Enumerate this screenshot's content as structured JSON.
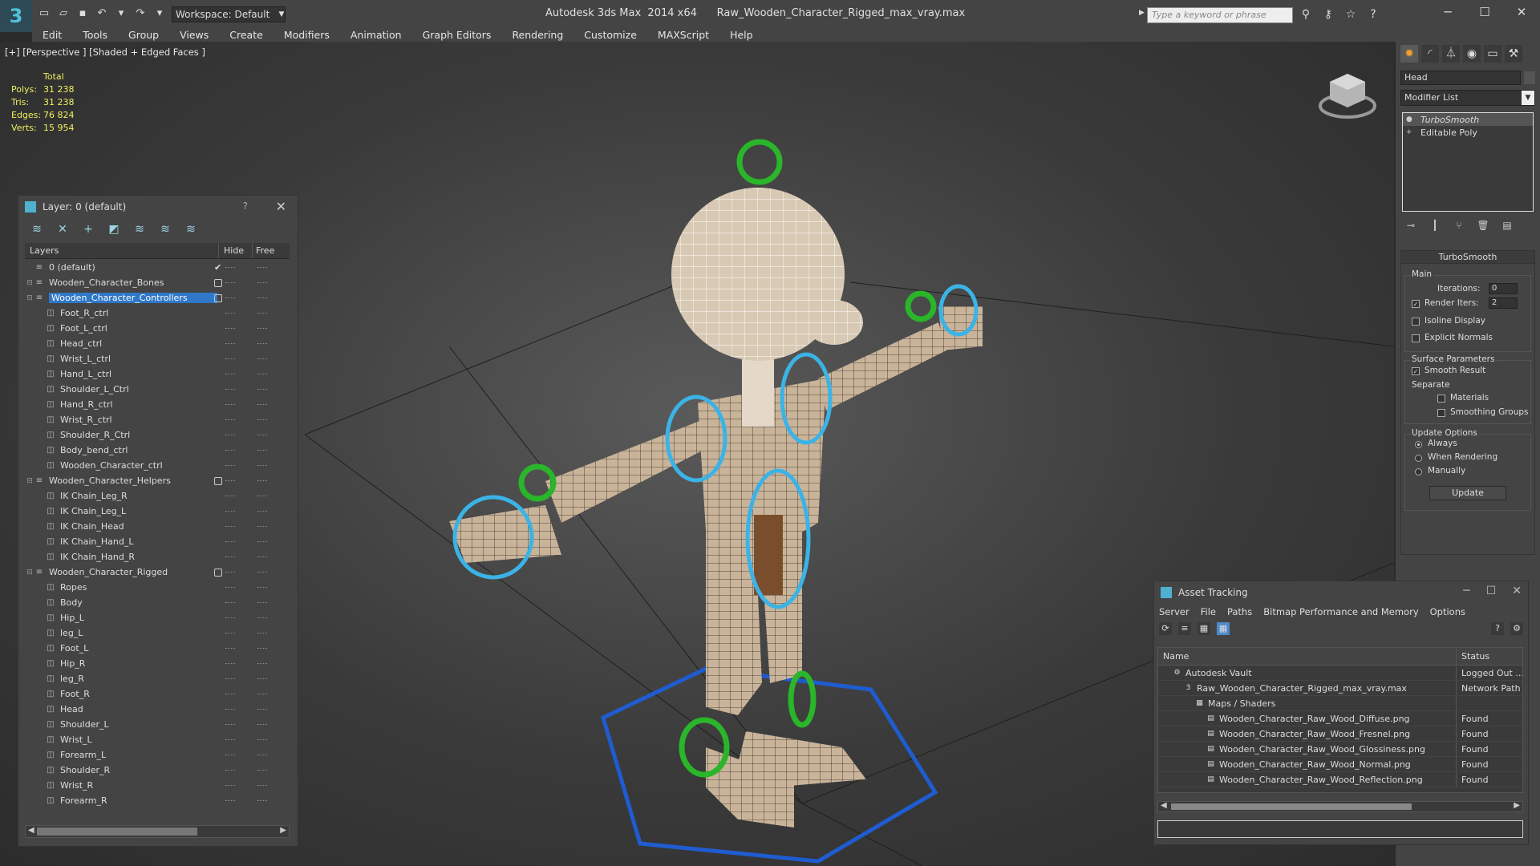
{
  "titlebar": {
    "workspace": "Workspace: Default",
    "app_title": "Autodesk 3ds Max  2014 x64      Raw_Wooden_Character_Rigged_max_vray.max",
    "search_placeholder": "Type a keyword or phrase"
  },
  "menu": [
    "Edit",
    "Tools",
    "Group",
    "Views",
    "Create",
    "Modifiers",
    "Animation",
    "Graph Editors",
    "Rendering",
    "Customize",
    "MAXScript",
    "Help"
  ],
  "viewport": {
    "label": "[+] [Perspective ] [Shaded + Edged Faces ]",
    "stats": {
      "header": "Total",
      "rows": [
        {
          "k": "Polys:",
          "v": "31 238"
        },
        {
          "k": "Tris:",
          "v": "31 238"
        },
        {
          "k": "Edges:",
          "v": "76 824"
        },
        {
          "k": "Verts:",
          "v": "15 954"
        }
      ]
    }
  },
  "layer_window": {
    "title": "Layer: 0 (default)",
    "help": "?",
    "col_layers": "Layers",
    "col_hide": "Hide",
    "col_freeze": "Free",
    "rows": [
      {
        "name": "0 (default)",
        "level": 0,
        "exp": "",
        "mark": "tick"
      },
      {
        "name": "Wooden_Character_Bones",
        "level": 0,
        "exp": "+",
        "mark": "box"
      },
      {
        "name": "Wooden_Character_Controllers",
        "level": 0,
        "exp": "−",
        "mark": "box",
        "selected": true
      },
      {
        "name": "Foot_R_ctrl",
        "level": 1
      },
      {
        "name": "Foot_L_ctrl",
        "level": 1
      },
      {
        "name": "Head_ctrl",
        "level": 1
      },
      {
        "name": "Wrist_L_ctrl",
        "level": 1
      },
      {
        "name": "Hand_L_ctrl",
        "level": 1
      },
      {
        "name": "Shoulder_L_Ctrl",
        "level": 1
      },
      {
        "name": "Hand_R_ctrl",
        "level": 1
      },
      {
        "name": "Wrist_R_ctrl",
        "level": 1
      },
      {
        "name": "Shoulder_R_Ctrl",
        "level": 1
      },
      {
        "name": "Body_bend_ctrl",
        "level": 1
      },
      {
        "name": "Wooden_Character_ctrl",
        "level": 1
      },
      {
        "name": "Wooden_Character_Helpers",
        "level": 0,
        "exp": "−",
        "mark": "box"
      },
      {
        "name": "IK Chain_Leg_R",
        "level": 1
      },
      {
        "name": "IK Chain_Leg_L",
        "level": 1
      },
      {
        "name": "IK Chain_Head",
        "level": 1
      },
      {
        "name": "IK Chain_Hand_L",
        "level": 1
      },
      {
        "name": "IK Chain_Hand_R",
        "level": 1
      },
      {
        "name": "Wooden_Character_Rigged",
        "level": 0,
        "exp": "−",
        "mark": "box"
      },
      {
        "name": "Ropes",
        "level": 1
      },
      {
        "name": "Body",
        "level": 1
      },
      {
        "name": "Hip_L",
        "level": 1
      },
      {
        "name": "leg_L",
        "level": 1
      },
      {
        "name": "Foot_L",
        "level": 1
      },
      {
        "name": "Hip_R",
        "level": 1
      },
      {
        "name": "leg_R",
        "level": 1
      },
      {
        "name": "Foot_R",
        "level": 1
      },
      {
        "name": "Head",
        "level": 1
      },
      {
        "name": "Shoulder_L",
        "level": 1
      },
      {
        "name": "Wrist_L",
        "level": 1
      },
      {
        "name": "Forearm_L",
        "level": 1
      },
      {
        "name": "Shoulder_R",
        "level": 1
      },
      {
        "name": "Wrist_R",
        "level": 1
      },
      {
        "name": "Forearm_R",
        "level": 1
      }
    ]
  },
  "command_panel": {
    "object_name": "Head",
    "modifier_list": "Modifier List",
    "stack": [
      "TurboSmooth",
      "Editable Poly"
    ],
    "rollout_title": "TurboSmooth",
    "main_label": "Main",
    "iterations_label": "Iterations:",
    "iterations_value": "0",
    "render_iters_label": "Render Iters:",
    "render_iters_value": "2",
    "isoline_label": "Isoline Display",
    "explicit_normals_label": "Explicit Normals",
    "surface_params_label": "Surface Parameters",
    "smooth_result_label": "Smooth Result",
    "separate_label": "Separate",
    "materials_label": "Materials",
    "smoothing_groups_label": "Smoothing Groups",
    "update_options_label": "Update Options",
    "always_label": "Always",
    "when_rendering_label": "When Rendering",
    "manually_label": "Manually",
    "update_button": "Update"
  },
  "asset_tracking": {
    "title": "Asset Tracking",
    "menu": [
      "Server",
      "File",
      "Paths",
      "Bitmap Performance and Memory",
      "Options"
    ],
    "col_name": "Name",
    "col_status": "Status",
    "rows": [
      {
        "name": "Autodesk Vault",
        "status": "Logged Out ...",
        "indent": 1,
        "icon": "vault"
      },
      {
        "name": "Raw_Wooden_Character_Rigged_max_vray.max",
        "status": "Network Path",
        "indent": 2,
        "icon": "max"
      },
      {
        "name": "Maps / Shaders",
        "status": "",
        "indent": 3,
        "icon": "maps"
      },
      {
        "name": "Wooden_Character_Raw_Wood_Diffuse.png",
        "status": "Found",
        "indent": 4,
        "icon": "file"
      },
      {
        "name": "Wooden_Character_Raw_Wood_Fresnel.png",
        "status": "Found",
        "indent": 4,
        "icon": "file"
      },
      {
        "name": "Wooden_Character_Raw_Wood_Glossiness.png",
        "status": "Found",
        "indent": 4,
        "icon": "file"
      },
      {
        "name": "Wooden_Character_Raw_Wood_Normal.png",
        "status": "Found",
        "indent": 4,
        "icon": "file"
      },
      {
        "name": "Wooden_Character_Raw_Wood_Reflection.png",
        "status": "Found",
        "indent": 4,
        "icon": "file"
      }
    ]
  }
}
